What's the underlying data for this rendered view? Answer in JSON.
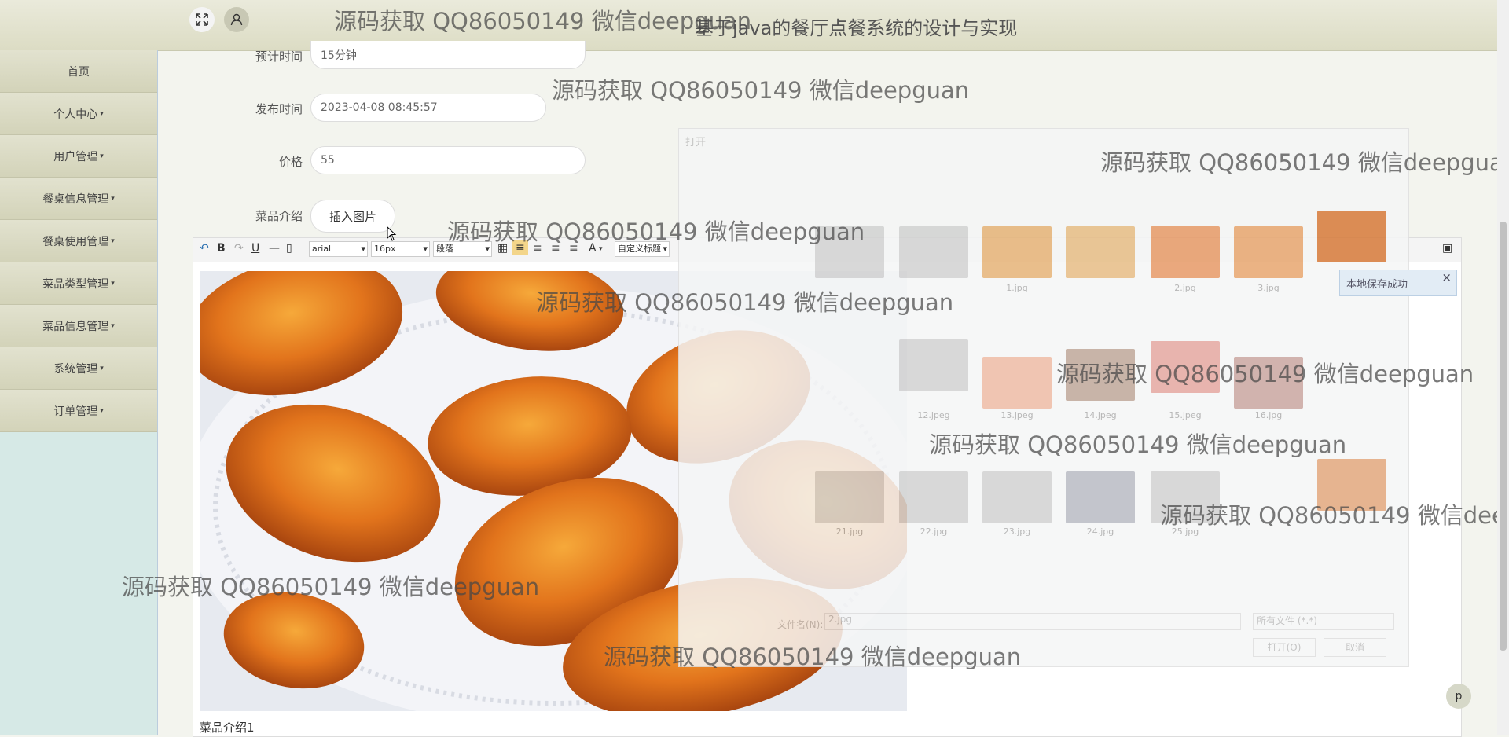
{
  "app": {
    "title": "基于java的餐厅点餐系统的设计与实现"
  },
  "topbar": {
    "expand_icon": "expand-icon",
    "user_icon": "user-icon"
  },
  "sidebar": {
    "items": [
      {
        "label": "首页",
        "caret": ""
      },
      {
        "label": "个人中心",
        "caret": "▾"
      },
      {
        "label": "用户管理",
        "caret": "▾"
      },
      {
        "label": "餐桌信息管理",
        "caret": "▾"
      },
      {
        "label": "餐桌使用管理",
        "caret": "▾"
      },
      {
        "label": "菜品类型管理",
        "caret": "▾"
      },
      {
        "label": "菜品信息管理",
        "caret": "▾"
      },
      {
        "label": "系统管理",
        "caret": "▾"
      },
      {
        "label": "订单管理",
        "caret": "▾"
      }
    ]
  },
  "form": {
    "estimated_time": {
      "label": "预计时间",
      "value": "15分钟"
    },
    "publish_time": {
      "label": "发布时间",
      "value": "2023-04-08 08:45:57"
    },
    "price": {
      "label": "价格",
      "value": "55"
    },
    "intro": {
      "label": "菜品介绍",
      "insert_button": "插入图片"
    }
  },
  "editor": {
    "font_family": "arial",
    "font_size": "16px",
    "paragraph": "段落",
    "custom_heading": "自定义标题",
    "caption": "菜品介绍1",
    "image_desc": "roasted chicken wings on a lace doily"
  },
  "file_dialog": {
    "title": "打开",
    "thumbnail_names": [
      "1.jpg",
      "2.jpg",
      "3.jpg",
      "12.jpeg",
      "13.jpeg",
      "14.jpeg",
      "15.jpeg",
      "16.jpg",
      "21.jpg",
      "22.jpg",
      "23.jpg",
      "24.jpg",
      "25.jpg"
    ],
    "filename_label": "文件名(N):",
    "filename_value": "2.jpg",
    "filetype": "所有文件 (*.*)",
    "open_button": "打开(O)",
    "cancel_button": "取消"
  },
  "toast": {
    "message": "本地保存成功",
    "close": "×"
  },
  "watermark": {
    "text": "源码获取 QQ86050149 微信deepguan"
  },
  "back_to_top": {
    "label": "p"
  },
  "colors": {
    "topbar": "#e3e3d0",
    "sidebar": "#d6e9e6",
    "sidebar_item": "#dcdcc4",
    "main_bg": "#f3f4ee"
  }
}
